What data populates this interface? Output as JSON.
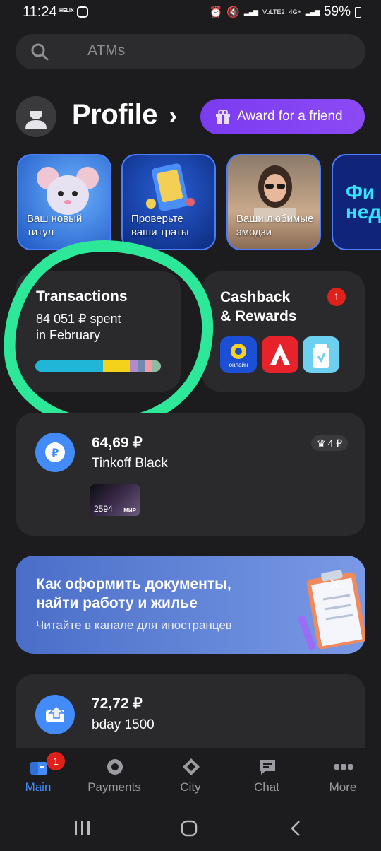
{
  "status_bar": {
    "time": "11:24",
    "battery": "59%"
  },
  "search": {
    "placeholder": "ATMs"
  },
  "profile": {
    "title": "Profile",
    "chevron": "›",
    "award_button": "Award for a friend"
  },
  "stories": [
    {
      "caption_line1": "Ваш новый",
      "caption_line2": "титул"
    },
    {
      "caption_line1": "Проверьте",
      "caption_line2": "ваши траты"
    },
    {
      "caption_line1": "Ваши любимые",
      "caption_line2": "эмодзи"
    },
    {
      "caption_line1": "Фи",
      "caption_line2": "нед"
    }
  ],
  "transactions": {
    "title": "Transactions",
    "amount_line": "84 051 ₽ spent",
    "period_line": "in February",
    "spend_breakdown_colors": [
      "#1fb6d8",
      "#f4d21c",
      "#b08cc8",
      "#6e8ab0",
      "#f29aa8",
      "#8dbd9e"
    ]
  },
  "cashback": {
    "title_line1": "Cashback",
    "title_line2": "& Rewards",
    "badge_count": "1",
    "partners": [
      {
        "label": "онлайн",
        "icon": "onlain-logo"
      },
      {
        "label": "",
        "icon": "auchan-logo"
      },
      {
        "label": "",
        "icon": "bottle-logo"
      }
    ]
  },
  "account": {
    "amount": "64,69 ₽",
    "name": "Tinkoff Black",
    "crown_badge": "4 ₽",
    "card_last_digits": "2594",
    "card_network": "МИР"
  },
  "promo": {
    "title_line1": "Как оформить документы,",
    "title_line2": "найти работу и жилье",
    "subtitle": "Читайте в канале для иностранцев"
  },
  "account2": {
    "amount": "72,72 ₽",
    "name": "bday 1500"
  },
  "tabs": [
    {
      "label": "Main",
      "icon": "main-icon",
      "active": true,
      "badge": "1"
    },
    {
      "label": "Payments",
      "icon": "payments-icon"
    },
    {
      "label": "City",
      "icon": "city-icon"
    },
    {
      "label": "Chat",
      "icon": "chat-icon"
    },
    {
      "label": "More",
      "icon": "more-icon"
    }
  ],
  "colors": {
    "accent": "#428bf9",
    "award_purple": "#7b3bf0",
    "annotation_green": "#2ee89a"
  }
}
